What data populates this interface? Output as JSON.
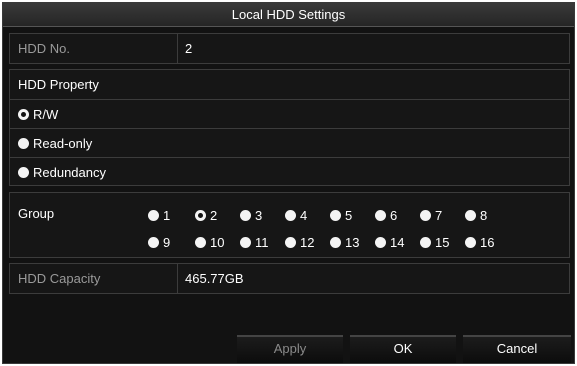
{
  "window": {
    "title": "Local HDD Settings"
  },
  "hdd_no": {
    "label": "HDD No.",
    "value": "2"
  },
  "property": {
    "heading": "HDD Property",
    "options": [
      {
        "label": "R/W",
        "selected": true
      },
      {
        "label": "Read-only",
        "selected": false
      },
      {
        "label": "Redundancy",
        "selected": false
      }
    ]
  },
  "group": {
    "label": "Group",
    "options": [
      "1",
      "2",
      "3",
      "4",
      "5",
      "6",
      "7",
      "8",
      "9",
      "10",
      "11",
      "12",
      "13",
      "14",
      "15",
      "16"
    ],
    "selected": "2"
  },
  "capacity": {
    "label": "HDD Capacity",
    "value": "465.77GB"
  },
  "buttons": {
    "apply": "Apply",
    "ok": "OK",
    "cancel": "Cancel"
  },
  "colors": {
    "background": "#121212",
    "panel_border": "#3c3c3c",
    "text": "#ffffff",
    "muted_text": "#9a9a9a"
  }
}
